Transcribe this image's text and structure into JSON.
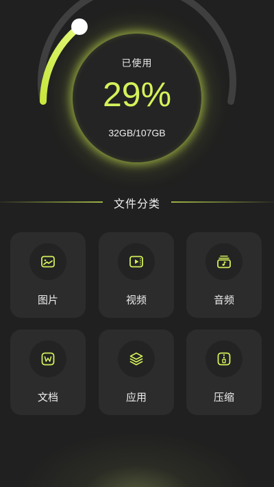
{
  "storage": {
    "used_label": "已使用",
    "used_percent": "29%",
    "used_fraction": 0.29,
    "used_amount": "32GB/107GB"
  },
  "section": {
    "title": "文件分类"
  },
  "categories": [
    {
      "label": "图片",
      "icon": "image-icon"
    },
    {
      "label": "视频",
      "icon": "video-icon"
    },
    {
      "label": "音频",
      "icon": "audio-icon"
    },
    {
      "label": "文档",
      "icon": "document-icon"
    },
    {
      "label": "应用",
      "icon": "layers-icon"
    },
    {
      "label": "压缩",
      "icon": "zip-icon"
    }
  ],
  "colors": {
    "accent": "#d4f25a",
    "background": "#202020",
    "tile": "#2c2c2c",
    "track": "#3f3f3f"
  }
}
